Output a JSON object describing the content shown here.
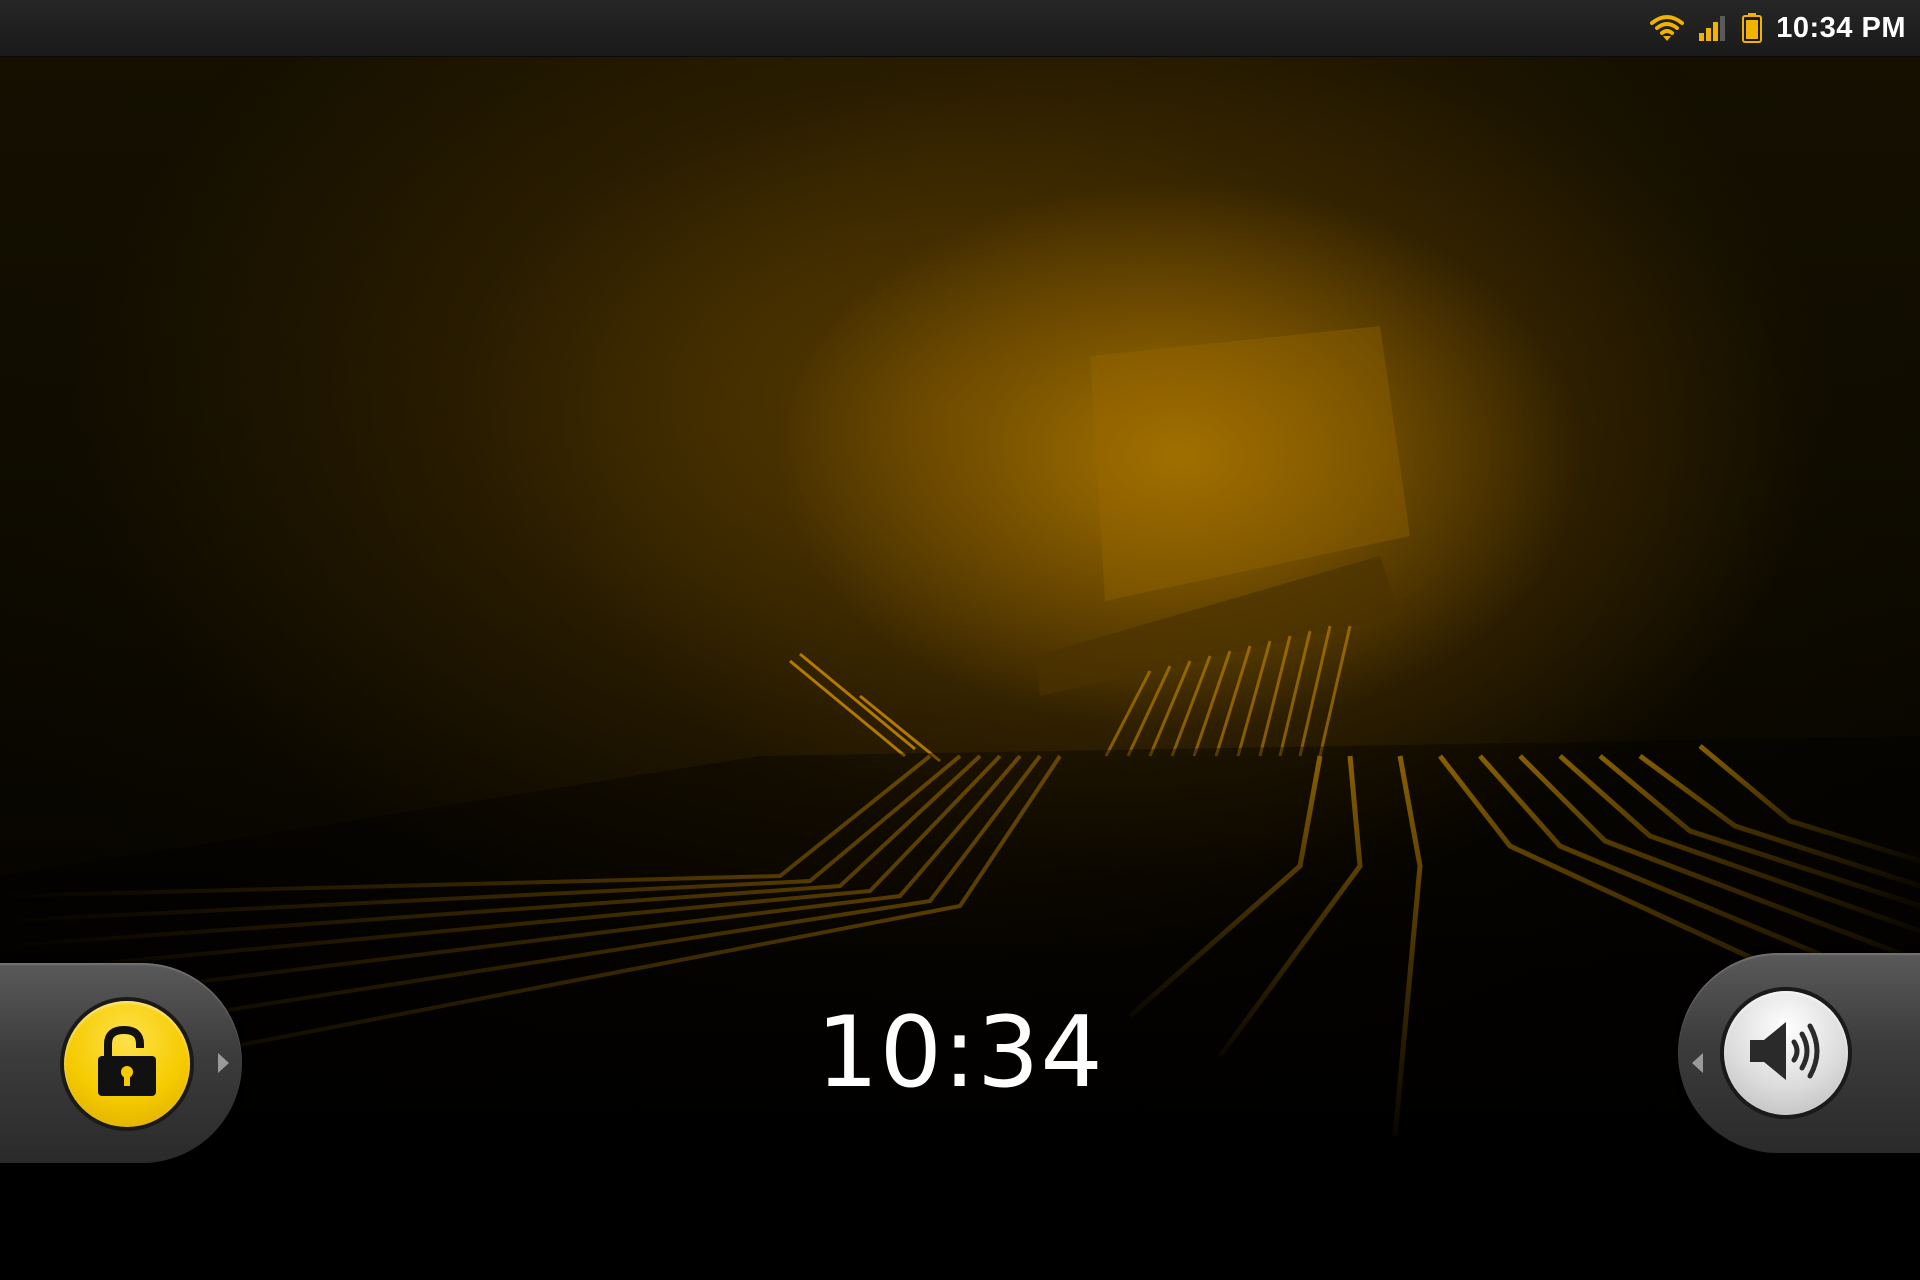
{
  "status_bar": {
    "time": "10:34 PM",
    "icons": [
      "wifi-icon",
      "signal-icon",
      "battery-icon"
    ],
    "icon_color": "#f0b400"
  },
  "lockscreen": {
    "clock": "10:34",
    "unlock_tab": {
      "icon": "unlock-icon",
      "color": "#f5cb00"
    },
    "sound_tab": {
      "icon": "speaker-icon",
      "color": "#d8d8d8"
    }
  },
  "wallpaper": {
    "accent": "#f0a800",
    "base": "#000000"
  }
}
